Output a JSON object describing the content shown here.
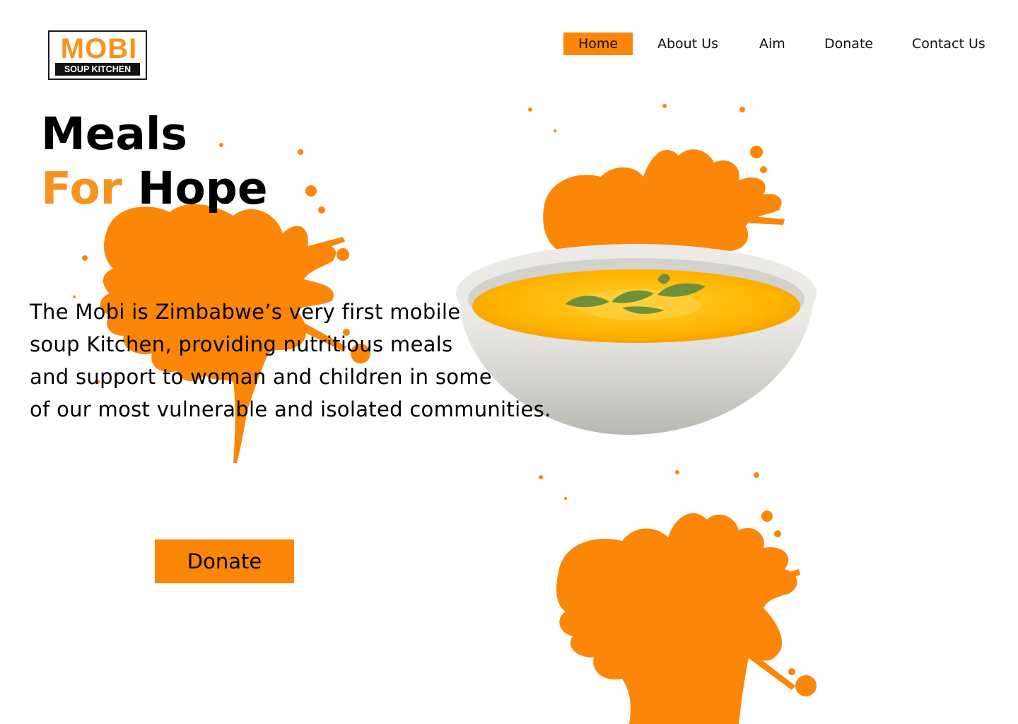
{
  "logo": {
    "main": "MOBI",
    "sub": "SOUP KITCHEN"
  },
  "nav": {
    "items": [
      {
        "label": "Home"
      },
      {
        "label": "About Us"
      },
      {
        "label": "Aim"
      },
      {
        "label": "Donate"
      },
      {
        "label": "Contact Us"
      }
    ],
    "active": "Home"
  },
  "hero": {
    "title_line1": "Meals",
    "title_line2_accent": "For",
    "title_line2_rest": "Hope",
    "description_lines": [
      "The Mobi is Zimbabwe’s very first mobile",
      "soup Kitchen, providing nutritious meals",
      "and support to woman and children in some",
      "of our most vulnerable and isolated communities."
    ],
    "donate_label": "Donate"
  },
  "colors": {
    "accent": "#fb8608",
    "text": "#000000",
    "background": "#ffffff"
  }
}
